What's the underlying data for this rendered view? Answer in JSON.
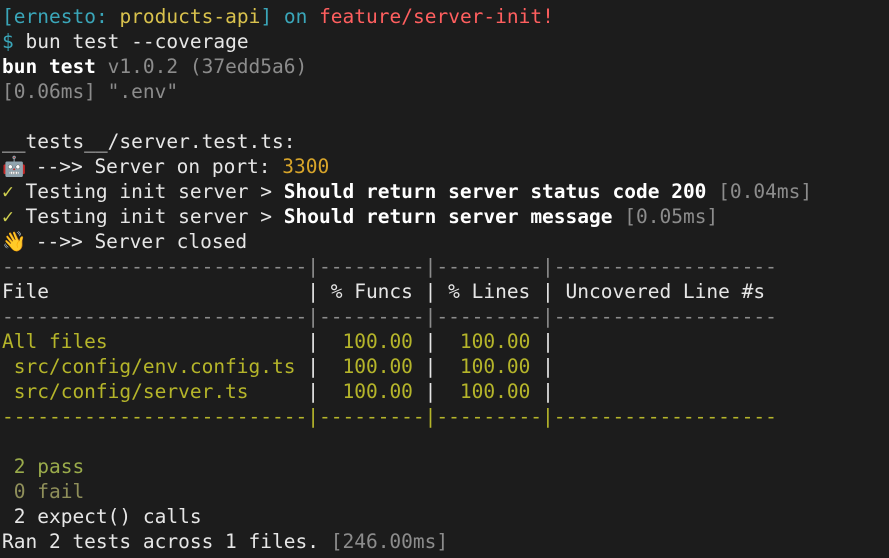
{
  "prompt": {
    "open": "[",
    "user": "ernesto",
    "colon": ":",
    "repo": "products-api",
    "close": "]",
    "on": "on",
    "branch": "feature/server-init",
    "bang": "!"
  },
  "command": {
    "dollar": "$",
    "text": "bun test --coverage"
  },
  "bun_header": {
    "name": "bun test",
    "version": "v1.0.2 (37edd5a6)"
  },
  "env_line": "[0.06ms] \".env\"",
  "test_file": "__tests__/server.test.ts:",
  "server_start": {
    "icon": "robot-icon",
    "text": " -->> Server on port: ",
    "port": "3300"
  },
  "results": [
    {
      "mark": "✓",
      "suite": " Testing init server > ",
      "name": "Should return server status code 200",
      "time": " [0.04ms]"
    },
    {
      "mark": "✓",
      "suite": " Testing init server > ",
      "name": "Should return server message",
      "time": " [0.05ms]"
    }
  ],
  "server_close": {
    "icon": "waving-hand-icon",
    "text": " -->> Server closed"
  },
  "coverage": {
    "sep_top": "--------------------------|---------|---------|-------------------",
    "header": "File                      | % Funcs | % Lines | Uncovered Line #s",
    "sep_mid": "--------------------------|---------|---------|-------------------",
    "rows": [
      {
        "file": "All files                 ",
        "funcs": "100.00",
        "lines": "100.00"
      },
      {
        "file": " src/config/env.config.ts ",
        "funcs": "100.00",
        "lines": "100.00"
      },
      {
        "file": " src/config/server.ts     ",
        "funcs": "100.00",
        "lines": "100.00"
      }
    ],
    "sep_bottom": "--------------------------|---------|---------|-------------------"
  },
  "summary": {
    "pass": " 2 pass",
    "fail": " 0 fail",
    "expect": " 2 expect() calls",
    "ran": "Ran 2 tests across 1 files. ",
    "ran_time": "[246.00ms]"
  },
  "colors": {
    "background": "#1c1c1c",
    "cyan": "#3aa6b9",
    "yellow": "#d9c24d",
    "red": "#ff5f5f",
    "olive": "#b5b52a",
    "gold": "#d8a52a"
  }
}
